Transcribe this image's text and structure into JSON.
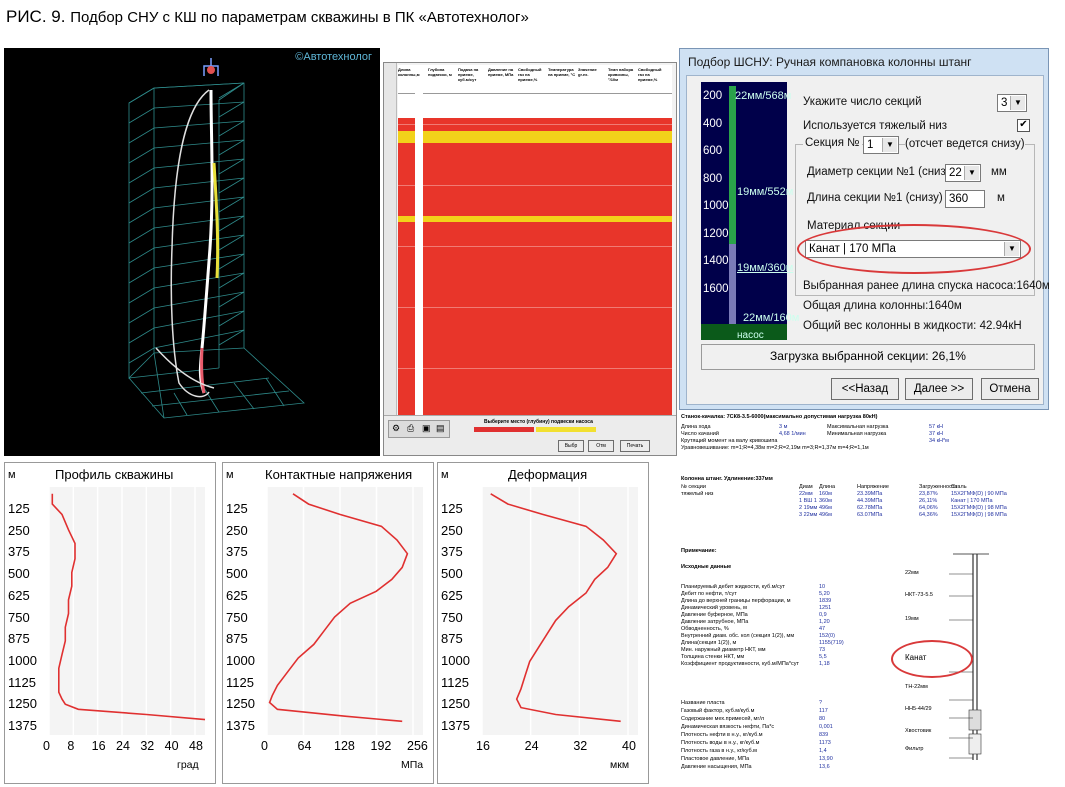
{
  "caption": {
    "number": "РИС. 9.",
    "text": "Подбор СНУ с КШ по параметрам скважины в ПК «Автотехнолог»"
  },
  "viewer3d": {
    "brand": "©Автотехнолог"
  },
  "sheet": {
    "header_cols": [
      "Длина колонны,м",
      "Глубина подвески, м",
      "Подача на приеме, куб.м/сут",
      "Давление на приеме, МПа",
      "Свободный газ на приеме,%",
      "Температура на приеме, °С",
      "Значение gr.ex.",
      "Темп набора кривизны, °/10м",
      "Свободный газ на приеме,%"
    ],
    "footer_title": "Выберите место (глубину) подвески насоса",
    "footer_btn_ok": "Выбр",
    "footer_btn_cancel": "Отм",
    "footer_btn_print": "Печать"
  },
  "dialog": {
    "title": "Подбор ШСНУ: Ручная компановка колонны штанг",
    "depth_ticks": [
      "200",
      "400",
      "600",
      "800",
      "1000",
      "1200",
      "1400",
      "1600"
    ],
    "column_labels": [
      "22мм/568м",
      "19мм/552м",
      "19мм/360м",
      "22мм/160м",
      "насос"
    ],
    "sections_label": "Укажите число секций",
    "sections_value": "3",
    "heavy_bottom_label": "Используется тяжелый низ",
    "heavy_bottom_checked": true,
    "section_no_label": "Секция №",
    "section_no_value": "1",
    "section_no_note": "(отсчет ведется снизу)",
    "diameter_label": "Диаметр секции №1 (снизу)",
    "diameter_value": "22",
    "diameter_unit": "мм",
    "length_label": "Длина секции №1 (снизу)",
    "length_value": "360",
    "length_unit": "м",
    "material_label": "Материал секции",
    "material_value": "Канат | 170 МПа",
    "pump_depth": "Выбранная ранее длина спуска насоса:1640м",
    "total_length": "Общая длина колонны:1640м",
    "total_weight": "Общий вес колонны в жидкости: 42.94кН",
    "load_status": "Загрузка выбранной секции: 26,1%",
    "btn_back": "<<Назад",
    "btn_next": "Далее >>",
    "btn_cancel": "Отмена"
  },
  "report": {
    "line1": "Станок-качалка: 7СК8-3.5-6000(максимально допустимая нагрузка 80кН)",
    "rows_top": [
      [
        "Длина хода",
        "3 м",
        "Максимальная нагрузка",
        "57 кН"
      ],
      [
        "Число качаний",
        "4,68 1/мин",
        "Минимальная нагрузка",
        "37 кН"
      ],
      [
        "Крутящий момент на валу кривошипа",
        "",
        "",
        "34 кН*м"
      ],
      [
        "Уравновешивание: m=1;R=4,38м   m=2;R=2,19м   m=3;R=1,37м   m=4;R=1,1м",
        "",
        "",
        ""
      ]
    ],
    "col_title": "Колонна штанг. Удлинение:337мм",
    "col_headers": [
      "№ секции",
      "Диам",
      "Длина",
      "Напряжение",
      "Загруженность",
      "Сталь"
    ],
    "col_rows": [
      [
        "тяжелый низ",
        "22мм",
        "160м",
        "23.39МПа",
        "23,87%",
        "15Х2ГМФ(D) | 90 МПа"
      ],
      [
        "",
        "1 ВШ 1",
        "360м",
        "44.39МПа",
        "26,11%",
        "Канат | 170 МПа"
      ],
      [
        "",
        "2 19мм",
        "496м",
        "62.78МПа",
        "64,06%",
        "15Х2ГМФ(D) | 98 МПа"
      ],
      [
        "",
        "3 22мм",
        "496м",
        "63.07МПа",
        "64,36%",
        "15Х2ГМФ(D) | 98 МПа"
      ]
    ],
    "note": "Примечание:",
    "source_title": "Исходные данные",
    "source_rows": [
      [
        "Планируемый дебит жидкости, куб.м/сут",
        "10"
      ],
      [
        "Дебит по нефти, т/сут",
        "5,20"
      ],
      [
        "Длина до верхней границы перфорации, м",
        "1839"
      ],
      [
        "Динамический уровень, м",
        "1251"
      ],
      [
        "Давление буферное, МПа",
        "0,9"
      ],
      [
        "Давление затрубное, МПа",
        "1,20"
      ],
      [
        "Обводненность, %",
        "47"
      ],
      [
        "Внутренний диам. обс. кол (секция 1(2)), мм",
        "152(0)"
      ],
      [
        "Длина(секция 1(2)), м",
        "1155(719)"
      ],
      [
        "Мин. наружный диаметр НКТ, мм",
        "73"
      ],
      [
        "Толщина стенки НКТ, мм",
        "5,5"
      ],
      [
        "Коэффициент продуктивности, куб.м/МПа*сут",
        "1,18"
      ]
    ],
    "layer_rows": [
      [
        "Название пласта",
        "?"
      ],
      [
        "Газовый фактор, куб.м/куб.м",
        "117"
      ],
      [
        "Содержание мех.примесей, мг/л",
        "80"
      ],
      [
        "Динамическая вязкость нефти, Па*с",
        "0,001"
      ],
      [
        "Плотность нефти в н.у., кг/куб.м",
        "839"
      ],
      [
        "Плотность воды в н.у., кг/куб.м",
        "1173"
      ],
      [
        "Плотность газа в н.у., кг/куб.м",
        "1,4"
      ],
      [
        "Пластовое давление, МПа",
        "13,90"
      ],
      [
        "Давление насыщения, МПа",
        "13,6"
      ]
    ],
    "schematic_labels": [
      "22мм",
      "НКТ-73-5.5",
      "19мм",
      "Канат",
      "ТН-22мм",
      "НН5-44/29",
      "Хвостовик",
      "Фильтр"
    ]
  },
  "plots": [
    {
      "title": "Профиль скважины",
      "unit": "град",
      "xticks": [
        "0",
        "8",
        "16",
        "24",
        "32",
        "40",
        "48"
      ]
    },
    {
      "title": "Контактные напряжения",
      "unit": "МПа",
      "xticks": [
        "0",
        "64",
        "128",
        "192",
        "256"
      ]
    },
    {
      "title": "Деформация",
      "unit": "мкм",
      "xticks": [
        "16",
        "24",
        "32",
        "40"
      ]
    }
  ],
  "plot_axis": {
    "m_label": "м",
    "yticks": [
      "125",
      "250",
      "375",
      "500",
      "625",
      "750",
      "875",
      "1000",
      "1125",
      "1250",
      "1375"
    ]
  },
  "chart_data": [
    {
      "type": "line",
      "title": "Профиль скважины",
      "xlabel": "град",
      "ylabel": "м",
      "xlim": [
        0,
        48
      ],
      "ylim": [
        1450,
        0
      ],
      "series": [
        {
          "x": [
            1,
            1,
            4,
            6,
            8,
            8,
            7,
            7,
            6,
            6,
            5,
            5,
            4,
            3,
            3,
            3,
            4,
            5,
            9,
            30,
            48
          ],
          "y": [
            40,
            100,
            160,
            250,
            330,
            420,
            500,
            580,
            660,
            740,
            820,
            900,
            980,
            1060,
            1140,
            1200,
            1240,
            1270,
            1300,
            1330,
            1360
          ]
        }
      ]
    },
    {
      "type": "line",
      "title": "Контактные напряжения",
      "xlabel": "МПа",
      "ylabel": "м",
      "xlim": [
        0,
        300
      ],
      "ylim": [
        1450,
        0
      ],
      "series": [
        {
          "x": [
            50,
            80,
            140,
            220,
            250,
            270,
            260,
            240,
            210,
            160,
            130,
            110,
            90,
            60,
            40,
            20,
            10,
            5,
            20,
            150,
            260
          ],
          "y": [
            40,
            100,
            160,
            230,
            310,
            390,
            470,
            540,
            610,
            680,
            760,
            840,
            920,
            1000,
            1080,
            1160,
            1220,
            1260,
            1300,
            1340,
            1370
          ]
        }
      ]
    },
    {
      "type": "line",
      "title": "Деформация",
      "xlabel": "мкм",
      "ylabel": "м",
      "xlim": [
        10,
        46
      ],
      "ylim": [
        1450,
        0
      ],
      "series": [
        {
          "x": [
            12,
            16,
            24,
            34,
            38,
            41,
            39,
            36,
            34,
            30,
            27,
            25,
            23,
            21,
            20,
            19,
            18,
            19,
            27,
            42
          ],
          "y": [
            40,
            100,
            160,
            230,
            310,
            390,
            470,
            540,
            620,
            700,
            780,
            860,
            940,
            1020,
            1100,
            1180,
            1240,
            1290,
            1330,
            1370
          ]
        }
      ]
    }
  ]
}
